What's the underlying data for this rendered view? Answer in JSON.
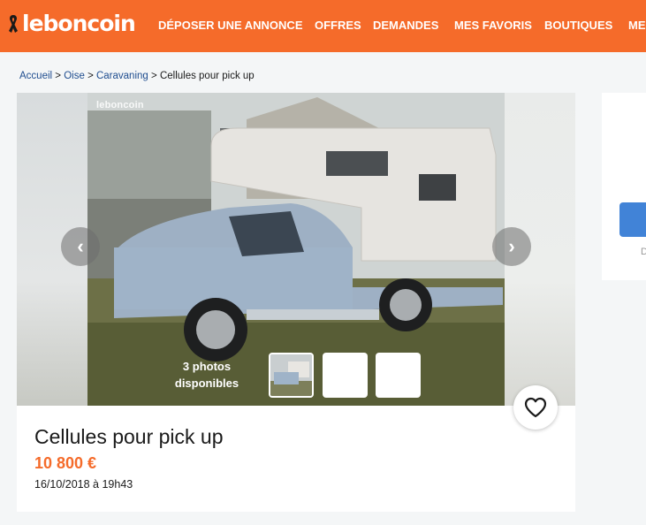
{
  "header": {
    "logo_text": "leboncoin",
    "nav": [
      {
        "label": "DÉPOSER UNE ANNONCE"
      },
      {
        "label": "OFFRES"
      },
      {
        "label": "DEMANDES"
      },
      {
        "label": "MES FAVORIS"
      },
      {
        "label": "BOUTIQUES"
      },
      {
        "label": "MES"
      }
    ],
    "color": "#f56b2a"
  },
  "breadcrumb": {
    "items": [
      "Accueil",
      "Oise",
      "Caravaning"
    ],
    "separator": ">",
    "current": "Cellules pour pick up"
  },
  "gallery": {
    "watermark": "leboncoin",
    "photos_count_line1": "3 photos",
    "photos_count_line2": "disponibles",
    "thumb_count": 3,
    "prev_icon": "chevron-left-icon",
    "next_icon": "chevron-right-icon"
  },
  "sidebar": {
    "ghost_text": "D"
  },
  "ad": {
    "title": "Cellules pour pick up",
    "price": "10 800 €",
    "date": "16/10/2018 à 19h43",
    "favorite_icon": "heart-icon",
    "price_color": "#f56b2a"
  }
}
